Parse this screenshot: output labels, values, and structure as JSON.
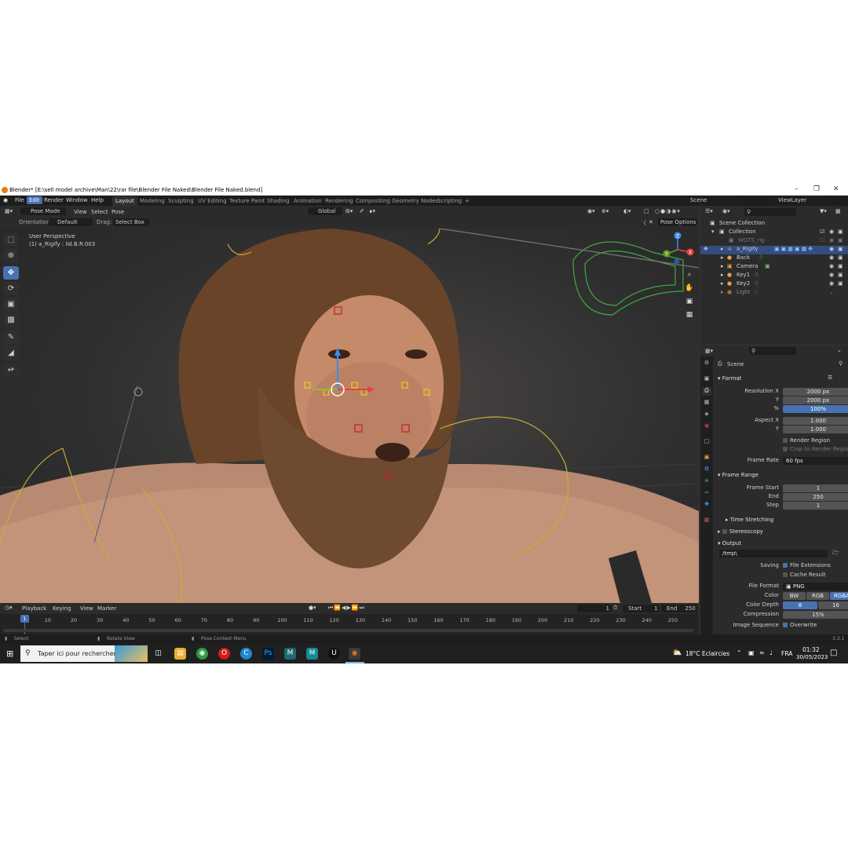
{
  "window": {
    "title": "Blender* [E:\\sell model archive\\Man\\22\\rar file\\Blender File Naked\\Blender File Naked.blend]"
  },
  "menu": [
    "File",
    "Edit",
    "Render",
    "Window",
    "Help"
  ],
  "workspaces": [
    "Layout",
    "Modeling",
    "Sculpting",
    "UV Editing",
    "Texture Paint",
    "Shading",
    "Animation",
    "Rendering",
    "Compositing",
    "Geometry Nodes",
    "Scripting",
    "+"
  ],
  "top_right": {
    "scene": "Scene",
    "view_layer": "ViewLayer"
  },
  "header": {
    "mode": "Pose Mode",
    "menus": [
      "View",
      "Select",
      "Pose"
    ],
    "transform": "Global",
    "orientation_label": "Orientation:",
    "orientation_value": "Default",
    "drag_label": "Drag:",
    "drag_value": "Select Box",
    "pose_options": "Pose Options"
  },
  "viewport": {
    "perspective": "User Perspective",
    "active": "(1) a_Rigify : lid.B.R.003",
    "gizmo_axes": [
      "Z",
      "Y",
      "X"
    ]
  },
  "outliner": {
    "rows": [
      {
        "label": "Scene Collection"
      },
      {
        "label": "Collection"
      },
      {
        "label": "WGTS_rig"
      },
      {
        "label": "a_Rigify"
      },
      {
        "label": "Back"
      },
      {
        "label": "Camera"
      },
      {
        "label": "Key1"
      },
      {
        "label": "Key2"
      },
      {
        "label": "Light"
      }
    ]
  },
  "properties": {
    "context": "Scene",
    "format": {
      "title": "Format",
      "resolution_x_label": "Resolution X",
      "resolution_x": "2000 px",
      "resolution_y_label": "Y",
      "resolution_y": "2000 px",
      "percent_label": "%",
      "percent": "100%",
      "aspect_x_label": "Aspect X",
      "aspect_x": "1.000",
      "aspect_y_label": "Y",
      "aspect_y": "1.000",
      "render_region": "Render Region",
      "crop_region": "Crop to Render Region",
      "frame_rate_label": "Frame Rate",
      "frame_rate": "60 fps"
    },
    "frame_range": {
      "title": "Frame Range",
      "start_label": "Frame Start",
      "start": "1",
      "end_label": "End",
      "end": "250",
      "step_label": "Step",
      "step": "1"
    },
    "time_stretching": "Time Stretching",
    "stereoscopy": "Stereoscopy",
    "output": {
      "title": "Output",
      "path": "/tmp\\",
      "saving_label": "Saving",
      "file_extensions": "File Extensions",
      "cache_result": "Cache Result",
      "file_format_label": "File Format",
      "file_format": "PNG",
      "color_label": "Color",
      "color_options": [
        "BW",
        "RGB",
        "RGBA"
      ],
      "color_depth_label": "Color Depth",
      "color_depth_options": [
        "8",
        "16"
      ],
      "compression_label": "Compression",
      "compression": "15%",
      "image_sequence_label": "Image Sequence",
      "overwrite": "Overwrite"
    }
  },
  "timeline": {
    "menus": [
      "Playback",
      "Keying",
      "View",
      "Marker"
    ],
    "current_frame": "1",
    "start_label": "Start",
    "start": "1",
    "end_label": "End",
    "end": "250",
    "ticks": [
      "1",
      "10",
      "20",
      "30",
      "40",
      "50",
      "60",
      "70",
      "80",
      "90",
      "100",
      "110",
      "120",
      "130",
      "140",
      "150",
      "160",
      "170",
      "180",
      "190",
      "200",
      "210",
      "220",
      "230",
      "240",
      "250"
    ]
  },
  "status": {
    "select": "Select",
    "rotate": "Rotate View",
    "context_menu": "Pose Context Menu",
    "version": "3.3.1"
  },
  "taskbar": {
    "search_placeholder": "Taper ici pour rechercher",
    "weather": "18°C Eclaircies",
    "language": "FRA",
    "time": "01:32",
    "date": "30/05/2023"
  },
  "colors": {
    "accent": "#4772b3",
    "selected_row": "#334d80",
    "blender_orange": "#e87d0d"
  }
}
